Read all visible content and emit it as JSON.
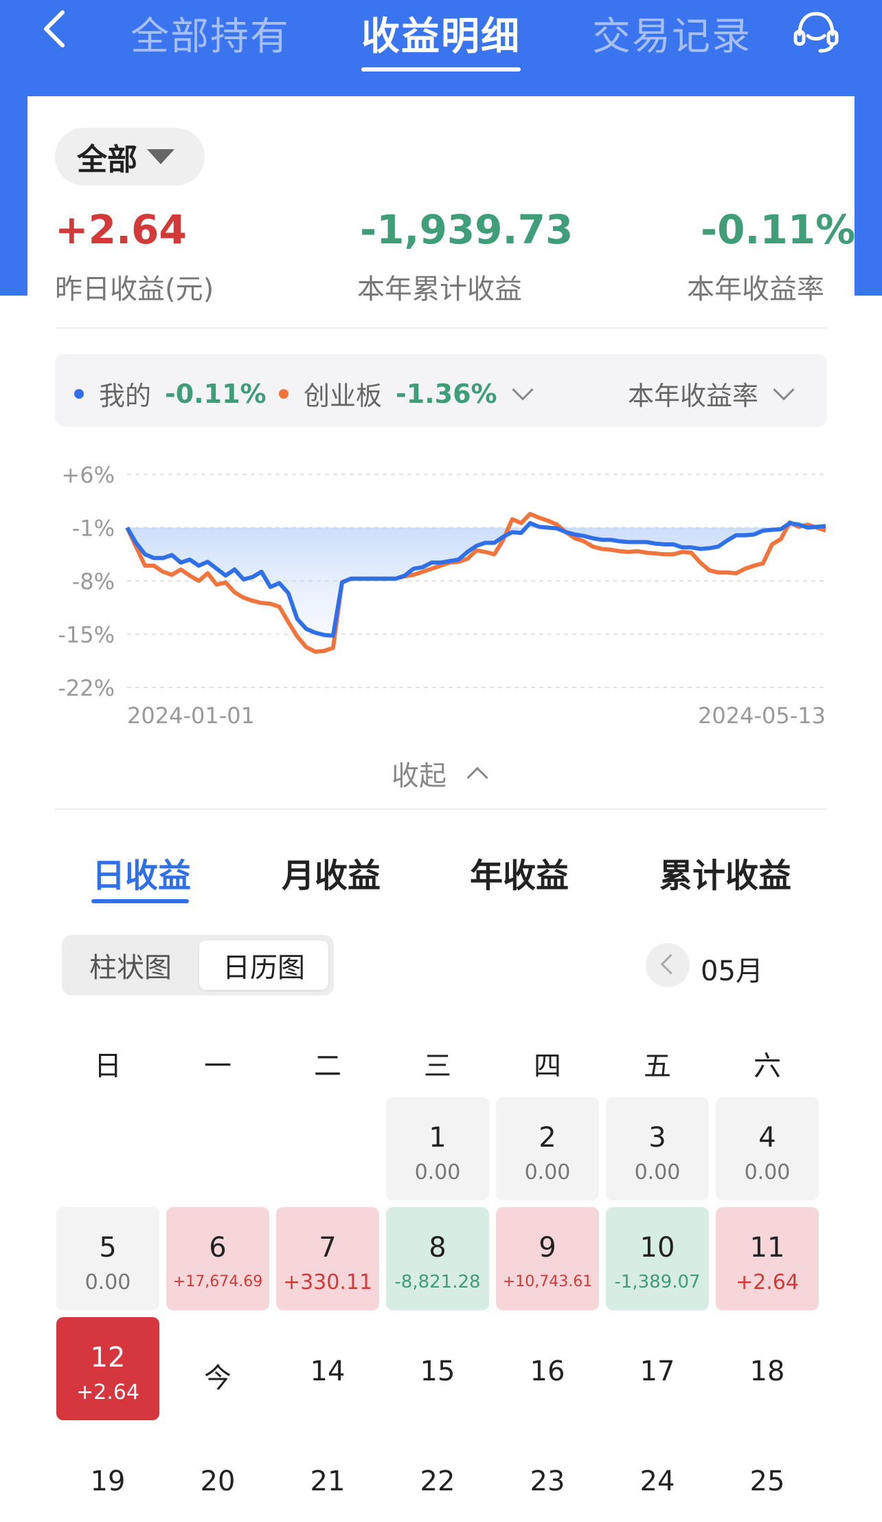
{
  "nav": {
    "tabs": [
      "全部持有",
      "收益明细",
      "交易记录"
    ],
    "active_tab": "收益明细"
  },
  "filter": {
    "label": "全部"
  },
  "stats": {
    "yesterday": {
      "value": "+2.64",
      "label": "昨日收益(元)"
    },
    "ytd_total": {
      "value": "-1,939.73",
      "label": "本年累计收益"
    },
    "ytd_rate": {
      "value": "-0.11%",
      "label": "本年收益率"
    }
  },
  "legend": {
    "mine_label": "我的",
    "mine_value": "-0.11%",
    "bench_label": "创业板",
    "bench_value": "-1.36%",
    "metric_label": "本年收益率"
  },
  "colors": {
    "accent_blue": "#3a74ee",
    "mine_line": "#2f6fe8",
    "bench_line": "#f0743c",
    "positive": "#d23a3a",
    "negative": "#3f9d7a"
  },
  "chart_data": {
    "type": "line",
    "x_start_label": "2024-01-01",
    "x_end_label": "2024-05-13",
    "yticks": [
      "+6%",
      "-1%",
      "-8%",
      "-15%",
      "-22%"
    ],
    "ylim": [
      -22,
      6
    ],
    "series": [
      {
        "name": "我的",
        "color": "#2f6fe8",
        "values": [
          -1,
          -3,
          -4.5,
          -5,
          -5,
          -4.6,
          -5.6,
          -5.2,
          -6,
          -5.5,
          -6.4,
          -7.3,
          -6.5,
          -7.8,
          -7.5,
          -6.8,
          -8.8,
          -8.3,
          -9.6,
          -13,
          -14.3,
          -14.8,
          -15.1,
          -15.2,
          -8.2,
          -7.7,
          -7.7,
          -7.7,
          -7.7,
          -7.7,
          -7.7,
          -7.3,
          -6.4,
          -6.2,
          -5.6,
          -5.6,
          -5.4,
          -5.2,
          -4.2,
          -3.4,
          -3.0,
          -3.0,
          -2.2,
          -1.6,
          -1.7,
          -0.4,
          -0.9,
          -1.0,
          -1.1,
          -1.6,
          -1.9,
          -2.1,
          -2.4,
          -2.6,
          -2.6,
          -2.8,
          -2.9,
          -2.9,
          -2.9,
          -3.1,
          -3.2,
          -3.2,
          -3.6,
          -3.6,
          -3.8,
          -3.7,
          -3.5,
          -2.7,
          -2.0,
          -2.0,
          -1.9,
          -1.4,
          -1.3,
          -1.2,
          -0.4,
          -0.6,
          -1.0,
          -0.9,
          -0.8
        ]
      },
      {
        "name": "创业板",
        "color": "#f0743c",
        "values": [
          -1,
          -3.5,
          -6,
          -6,
          -6.8,
          -7.2,
          -6.5,
          -7.3,
          -8.0,
          -7.0,
          -8.5,
          -8.2,
          -9.5,
          -10.2,
          -10.6,
          -10.9,
          -11,
          -11.4,
          -13.4,
          -15.3,
          -16.7,
          -17.3,
          -17.2,
          -16.8,
          -8.2,
          -7.7,
          -7.7,
          -7.7,
          -7.7,
          -7.7,
          -7.7,
          -7.4,
          -7.2,
          -6.8,
          -6.4,
          -6.0,
          -5.6,
          -5.5,
          -5.1,
          -4.0,
          -4.2,
          -4.5,
          -2.6,
          0.1,
          -0.4,
          0.8,
          0.3,
          -0.1,
          -0.6,
          -1.6,
          -2.4,
          -2.8,
          -3.5,
          -3.8,
          -3.9,
          -4.1,
          -4.2,
          -4.1,
          -4.3,
          -4.4,
          -4.5,
          -4.5,
          -4.2,
          -4.3,
          -5.6,
          -6.6,
          -6.9,
          -6.9,
          -7.0,
          -6.4,
          -6.0,
          -5.7,
          -3.2,
          -2.5,
          -0.3,
          -0.9,
          -0.6,
          -1.0,
          -1.4
        ]
      }
    ],
    "grid": true
  },
  "collapse_label": "收起",
  "period_tabs": [
    "日收益",
    "月收益",
    "年收益",
    "累计收益"
  ],
  "view_toggle": [
    "柱状图",
    "日历图"
  ],
  "month": "05月",
  "weekdays": [
    "日",
    "一",
    "二",
    "三",
    "四",
    "五",
    "六"
  ],
  "days": [
    {
      "num": "1",
      "amt": "0.00"
    },
    {
      "num": "2",
      "amt": "0.00"
    },
    {
      "num": "3",
      "amt": "0.00"
    },
    {
      "num": "4",
      "amt": "0.00"
    },
    {
      "num": "5",
      "amt": "0.00"
    },
    {
      "num": "6",
      "amt": "+17,674.69"
    },
    {
      "num": "7",
      "amt": "+330.11"
    },
    {
      "num": "8",
      "amt": "-8,821.28"
    },
    {
      "num": "9",
      "amt": "+10,743.61"
    },
    {
      "num": "10",
      "amt": "-1,389.07"
    },
    {
      "num": "11",
      "amt": "+2.64"
    },
    {
      "num": "12",
      "amt": "+2.64"
    },
    {
      "num": "今"
    },
    {
      "num": "14"
    },
    {
      "num": "15"
    },
    {
      "num": "16"
    },
    {
      "num": "17"
    },
    {
      "num": "18"
    },
    {
      "num": "19"
    },
    {
      "num": "20"
    },
    {
      "num": "21"
    },
    {
      "num": "22"
    },
    {
      "num": "23"
    },
    {
      "num": "24"
    },
    {
      "num": "25"
    }
  ]
}
